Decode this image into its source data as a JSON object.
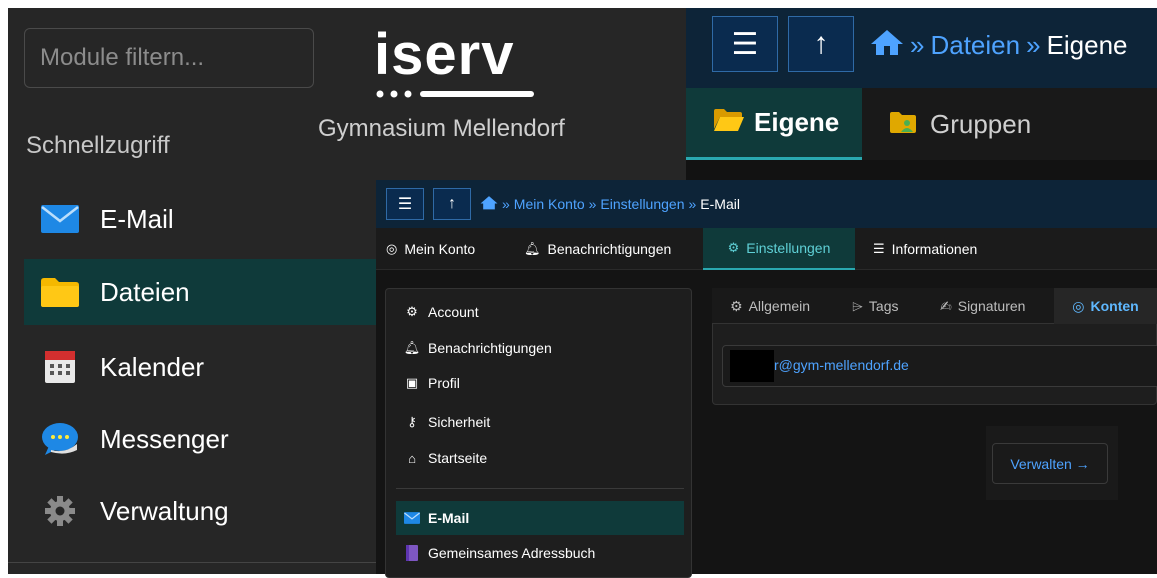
{
  "colors": {
    "sidebar_bg": "#262626",
    "topbar_bg": "#0d2438",
    "active_bg": "#0f3a3a",
    "link": "#4ea3ff",
    "accent": "#2aa8b0"
  },
  "sidebar": {
    "search_placeholder": "Module filtern...",
    "quick_access": "Schnellzugriff",
    "items": [
      {
        "label": "E-Mail",
        "icon": "envelope-icon"
      },
      {
        "label": "Dateien",
        "icon": "folder-icon",
        "active": true
      },
      {
        "label": "Kalender",
        "icon": "calendar-icon"
      },
      {
        "label": "Messenger",
        "icon": "chat-bubble-icon"
      },
      {
        "label": "Verwaltung",
        "icon": "gear-icon"
      }
    ]
  },
  "brand": {
    "logo": "iserv",
    "school": "Gymnasium Mellendorf"
  },
  "files_window": {
    "breadcrumb": [
      "Dateien",
      "Eigene"
    ],
    "tabs": [
      {
        "label": "Eigene",
        "icon": "open-folder-icon",
        "active": true
      },
      {
        "label": "Gruppen",
        "icon": "group-folder-icon"
      }
    ]
  },
  "settings_window": {
    "breadcrumb": [
      "Mein Konto",
      "Einstellungen",
      "E-Mail"
    ],
    "tabs": [
      {
        "label": "Mein Konto",
        "icon": "user-circle-icon"
      },
      {
        "label": "Benachrichtigungen",
        "icon": "bell-icon"
      },
      {
        "label": "Einstellungen",
        "icon": "gear-icon",
        "active": true
      },
      {
        "label": "Informationen",
        "icon": "list-icon"
      }
    ],
    "menu": [
      {
        "label": "Account",
        "icon": "gear-icon"
      },
      {
        "label": "Benachrichtigungen",
        "icon": "bell-icon"
      },
      {
        "label": "Profil",
        "icon": "id-card-icon"
      },
      {
        "label": "Sicherheit",
        "icon": "key-icon"
      },
      {
        "label": "Startseite",
        "icon": "home-icon"
      },
      {
        "label": "E-Mail",
        "icon": "envelope-icon",
        "active": true
      },
      {
        "label": "Gemeinsames Adressbuch",
        "icon": "address-book-icon"
      }
    ],
    "mail_tabs": [
      {
        "label": "Allgemein",
        "icon": "gear-icon"
      },
      {
        "label": "Tags",
        "icon": "tag-icon"
      },
      {
        "label": "Signaturen",
        "icon": "signature-icon"
      },
      {
        "label": "Konten",
        "icon": "user-circle-icon",
        "active": true
      }
    ],
    "account_email": "r@gym-mellendorf.de",
    "manage_button": "Verwalten →"
  }
}
